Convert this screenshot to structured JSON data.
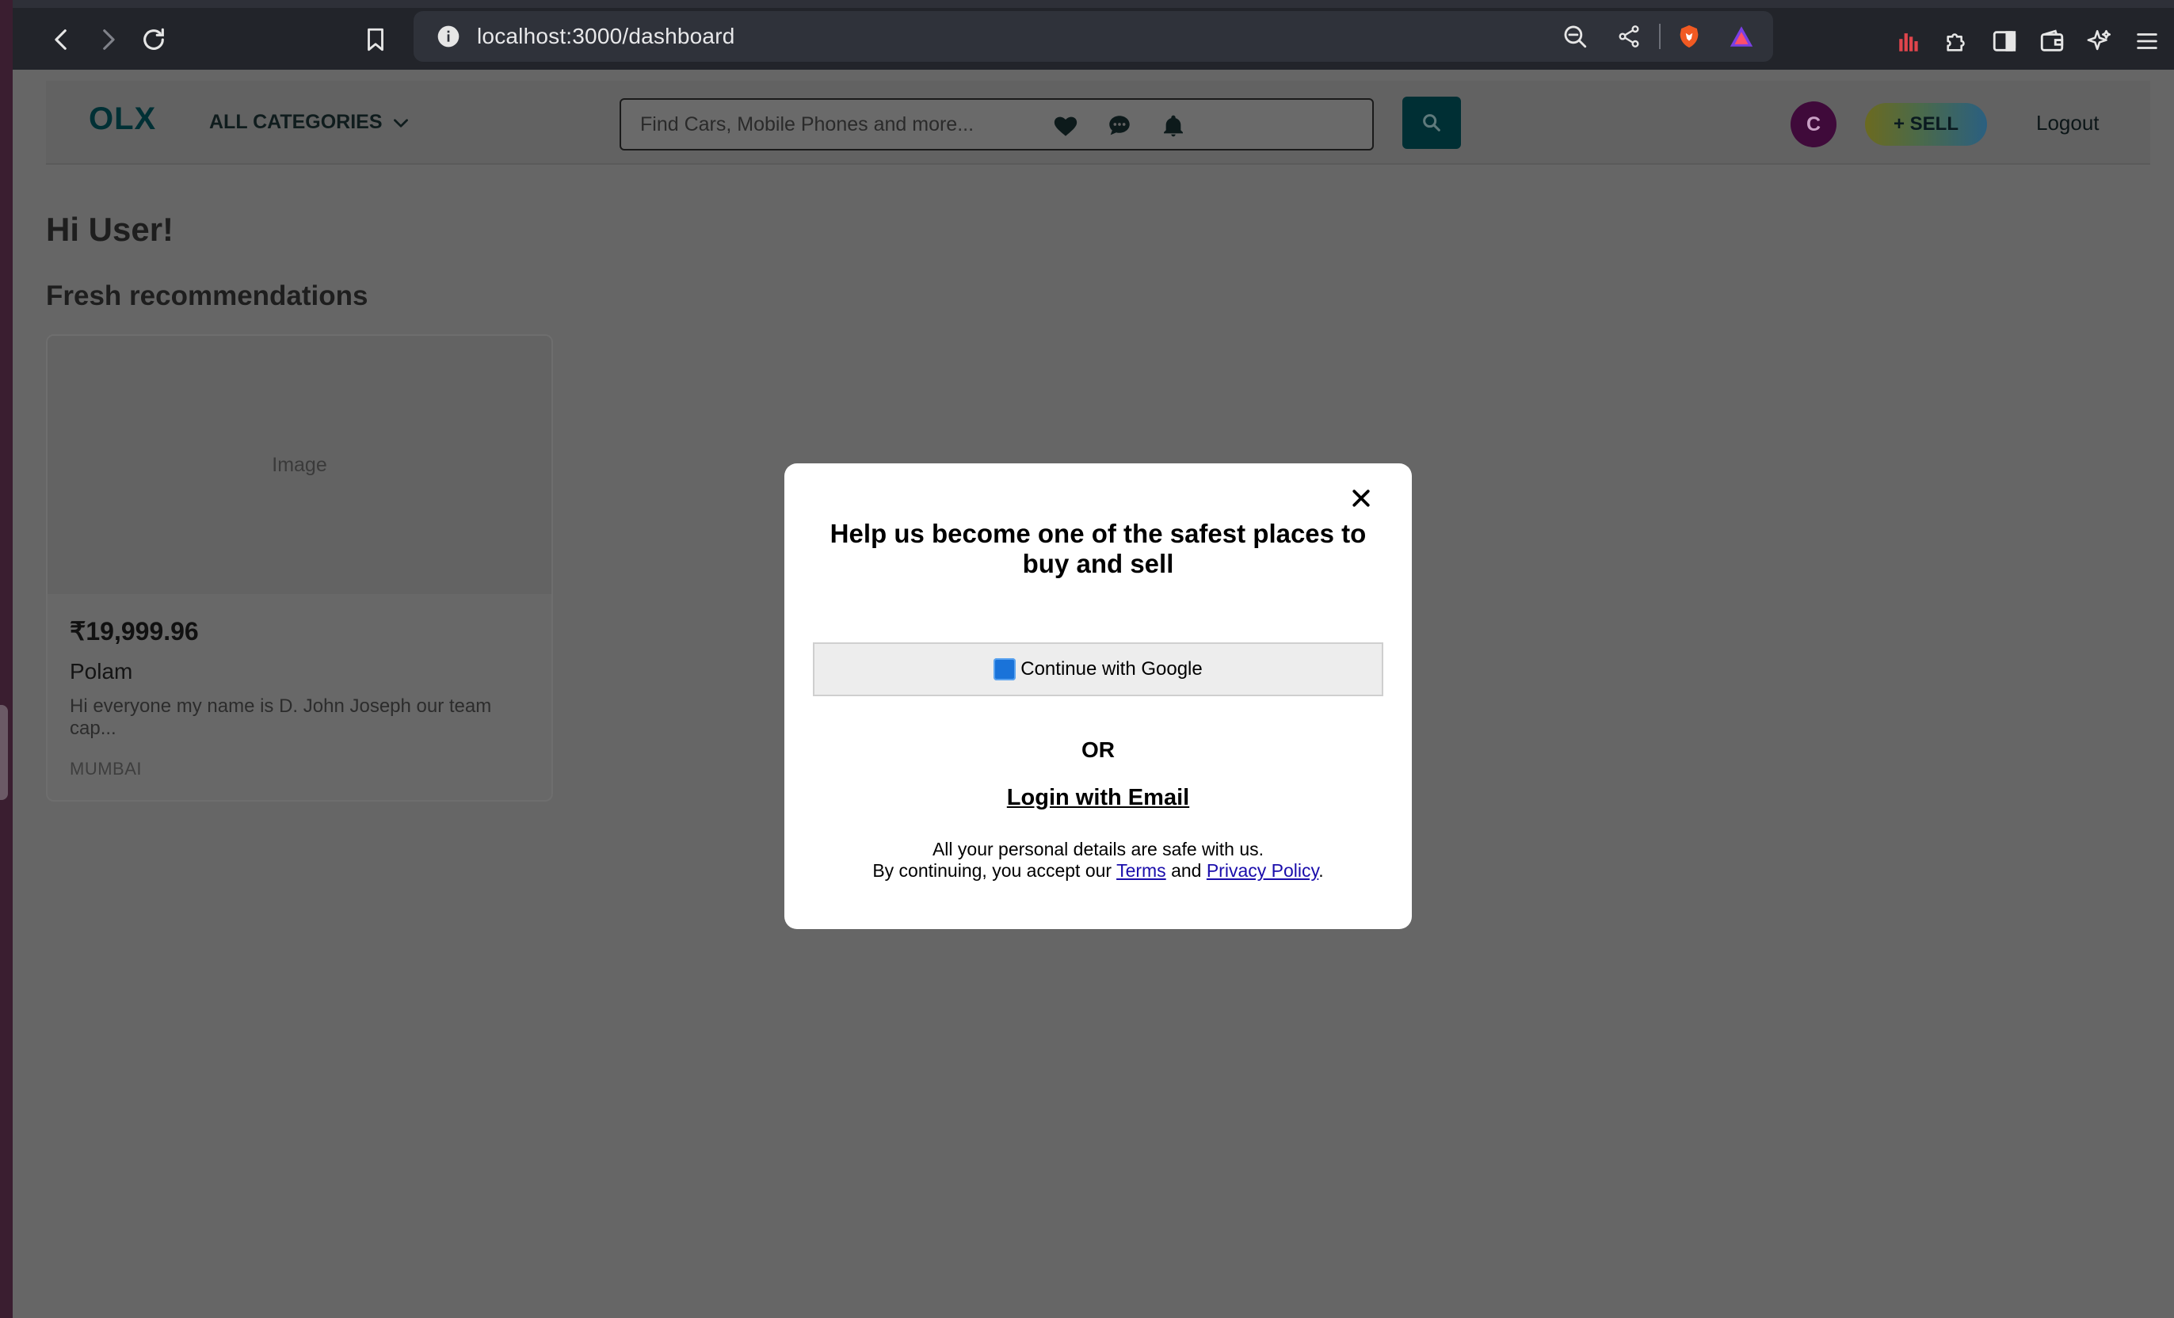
{
  "browser": {
    "url": "localhost:3000/dashboard"
  },
  "header": {
    "logo": "OLX",
    "categories_label": "ALL CATEGORIES",
    "search_placeholder": "Find Cars, Mobile Phones and more...",
    "avatar_initial": "C",
    "sell_label": "+ SELL",
    "logout_label": "Logout"
  },
  "main": {
    "greeting": "Hi User!",
    "section_title": "Fresh recommendations",
    "listings": [
      {
        "image_placeholder": "Image",
        "price": "₹19,999.96",
        "title": "Polam",
        "description": "Hi everyone my name is D. John Joseph our team cap...",
        "location": "MUMBAI"
      }
    ]
  },
  "modal": {
    "title": "Help us become one of the safest places to buy and sell",
    "google_button": "Continue with Google",
    "or_text": "OR",
    "email_login": "Login with Email",
    "legal_line1": "All your personal details are safe with us.",
    "legal_prefix": "By continuing, you accept our",
    "terms_link": "Terms",
    "and_text": "and",
    "privacy_link": "Privacy Policy",
    "legal_suffix": "."
  },
  "colors": {
    "brand": "#002f34",
    "overlay": "#666666",
    "link": "#1a0dab"
  }
}
